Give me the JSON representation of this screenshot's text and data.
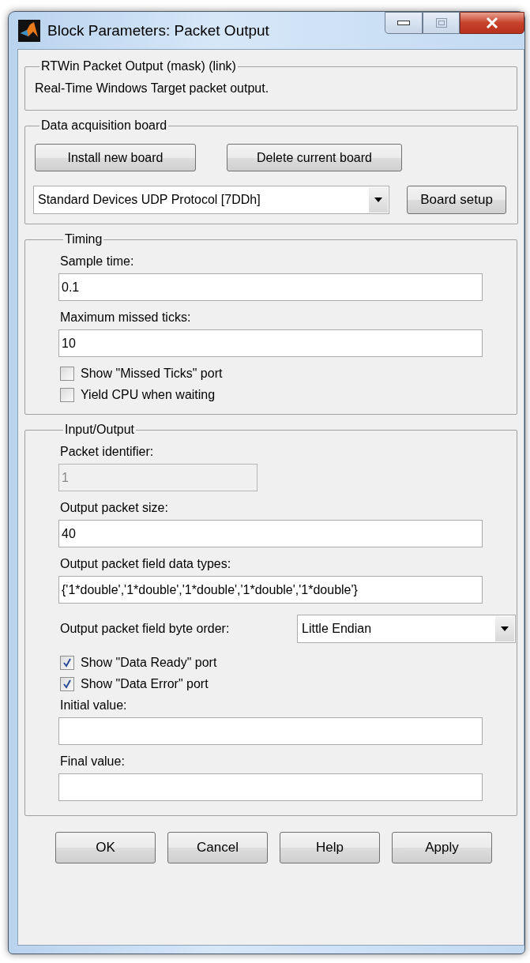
{
  "window": {
    "title": "Block Parameters: Packet Output"
  },
  "sections": [
    {
      "title": "RTWin Packet Output (mask) (link)",
      "items": [
        {
          "kind": "text",
          "text": "Real-Time Windows Target packet output."
        }
      ]
    },
    {
      "title": "Data acquisition board",
      "items": [
        {
          "kind": "buttons",
          "buttons": [
            "Install new board",
            "Delete current board"
          ]
        },
        {
          "kind": "dropdown",
          "value": "Standard Devices UDP Protocol [7DDh]",
          "button": "Board setup"
        }
      ]
    },
    {
      "title": "Timing",
      "items": [
        {
          "kind": "field",
          "label": "Sample time:",
          "value": "0.1",
          "disabled": false
        },
        {
          "kind": "field",
          "label": "Maximum missed ticks:",
          "value": "10",
          "disabled": false
        },
        {
          "kind": "checkbox",
          "label": "Show \"Missed Ticks\" port",
          "checked": false
        },
        {
          "kind": "checkbox",
          "label": "Yield CPU when waiting",
          "checked": false
        }
      ]
    },
    {
      "title": "Input/Output",
      "items": [
        {
          "kind": "field",
          "label": "Packet identifier:",
          "value": "1",
          "disabled": true
        },
        {
          "kind": "field",
          "label": "Output packet size:",
          "value": "40",
          "disabled": false
        },
        {
          "kind": "field",
          "label": "Output packet field data types:",
          "value": "{'1*double','1*double','1*double','1*double','1*double'}",
          "disabled": false
        },
        {
          "kind": "labeled_dropdown",
          "label": "Output packet field byte order:",
          "value": "Little Endian"
        },
        {
          "kind": "checkbox",
          "label": "Show \"Data Ready\" port",
          "checked": true
        },
        {
          "kind": "checkbox",
          "label": "Show \"Data Error\" port",
          "checked": true
        },
        {
          "kind": "field",
          "label": "Initial value:",
          "value": "",
          "disabled": false
        },
        {
          "kind": "field",
          "label": "Final value:",
          "value": "",
          "disabled": false
        }
      ]
    }
  ],
  "buttons": [
    "OK",
    "Cancel",
    "Help",
    "Apply"
  ]
}
